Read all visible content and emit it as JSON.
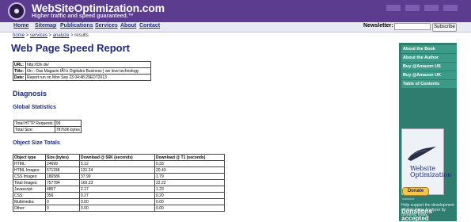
{
  "header": {
    "site_name": "WebSiteOptimization.com",
    "tagline": "Higher traffic and speed guaranteed.™"
  },
  "nav": {
    "items": [
      "Home",
      "Sitemap",
      "Publications",
      "Services",
      "About",
      "Contact"
    ],
    "newsletter_label": "Newsletter:",
    "subscribe_label": "Subscribe"
  },
  "breadcrumb": {
    "home": "home",
    "sep1": " > ",
    "services": "services",
    "sep2": " > ",
    "analyze": "analyze",
    "sep3": " > ",
    "current": "results"
  },
  "title": "Web Page Speed Report",
  "info": {
    "url_label": "URL:",
    "url_value": "http://t3n.de/",
    "title_label": "Title:",
    "title_value": "t3n - Das Magazin fÃ¼r Digitales Business | we love technology",
    "date_label": "Date:",
    "date_value": "Report run on Mon Sep 23 04:48:29EDT2013"
  },
  "diagnosis_heading": "Diagnosis",
  "global_heading": "Global Statistics",
  "global_stats": [
    {
      "label": "Total HTTP Requests:",
      "value": "99"
    },
    {
      "label": "Total Size:",
      "value": "787696 bytes"
    }
  ],
  "object_heading": "Object Size Totals",
  "object_table": {
    "headers": [
      "Object type",
      "Size (bytes)",
      "Download @ 56K (seconds)",
      "Download @ T1 (seconds)"
    ],
    "rows": [
      [
        "HTML:",
        "24699",
        "5.12",
        "0.33"
      ],
      [
        "HTML Images:",
        "571198",
        "131.24",
        "20.43"
      ],
      [
        "CSS Images:",
        "186586",
        "37.99",
        "1.79"
      ],
      [
        "Total Images:",
        "757784",
        "169.23",
        "22.22"
      ],
      [
        "Javascript:",
        "4857",
        "2.17",
        "1.23"
      ],
      [
        "CSS:",
        "356",
        "0.27",
        "0.20"
      ],
      [
        "Multimedia:",
        "0",
        "0.00",
        "0.00"
      ],
      [
        "Other:",
        "0",
        "0.00",
        "0.00"
      ]
    ]
  },
  "sidebar": {
    "items": [
      "About the Book",
      "About the Author",
      "Buy @Amazon US",
      "Buy @Amazon UK",
      "Table of Contents"
    ],
    "book_title": "Website Optimization",
    "donations_title": "Donations accepted",
    "donate_label": "Donate",
    "help_text": "Help support the development of Web Page Analyzer by donating today."
  }
}
